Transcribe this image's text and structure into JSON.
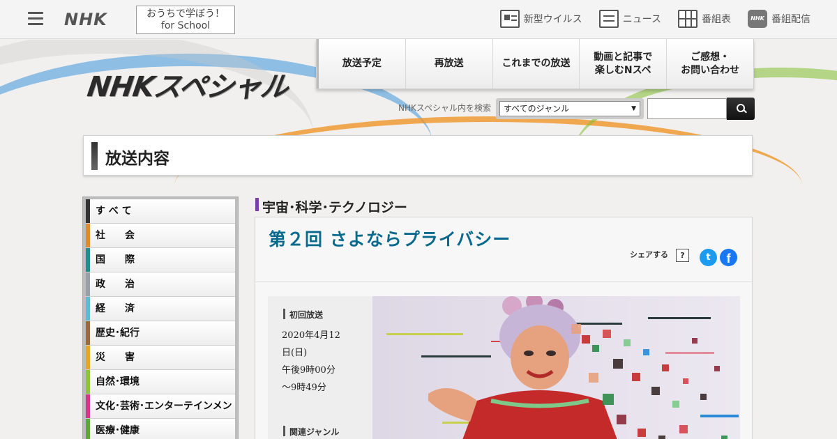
{
  "topbar": {
    "logo": "NHK",
    "school_line1": "おうちで学ぼう！",
    "school_line2": "for School",
    "links": [
      {
        "label": "新型ウイルス",
        "icon": "virus-info-icon"
      },
      {
        "label": "ニュース",
        "icon": "news-icon"
      },
      {
        "label": "番組表",
        "icon": "program-guide-icon"
      },
      {
        "label": "番組配信",
        "icon": "streaming-icon"
      }
    ]
  },
  "header": {
    "logo": "NHKスペシャル",
    "nav": [
      "放送予定",
      "再放送",
      "これまでの放送",
      "動画と記事で\n楽しむNスペ",
      "ご感想・\nお問い合わせ"
    ],
    "search": {
      "label": "NHKスペシャル内を検索",
      "genre_selected": "すべてのジャンル"
    }
  },
  "page": {
    "title": "放送内容"
  },
  "sidebar": {
    "items": [
      {
        "label": "す べ て",
        "color": "#333333"
      },
      {
        "label": "社　　会",
        "color": "#e08a2c"
      },
      {
        "label": "国　　際",
        "color": "#1f8e8e"
      },
      {
        "label": "政　　治",
        "color": "#9aa0a8"
      },
      {
        "label": "経　　済",
        "color": "#5bbbd0"
      },
      {
        "label": "歴史･紀行",
        "color": "#9a6a3a"
      },
      {
        "label": "災　　害",
        "color": "#e6a628"
      },
      {
        "label": "自然･環境",
        "color": "#8cc43a"
      },
      {
        "label": "文化･芸術･エンターテインメント",
        "color": "#d6368a"
      },
      {
        "label": "医療･健康",
        "color": "#5aa83a"
      }
    ]
  },
  "content": {
    "genre": "宇宙･科学･テクノロジー",
    "episode_title": "第２回 さよならプライバシー",
    "share_label": "シェアする",
    "help_label": "?",
    "first_air_label": "初回放送",
    "first_air_date": "2020年4月12\n日(日)\n午後9時00分\n～9時49分",
    "related_genre_label": "関連ジャンル"
  }
}
